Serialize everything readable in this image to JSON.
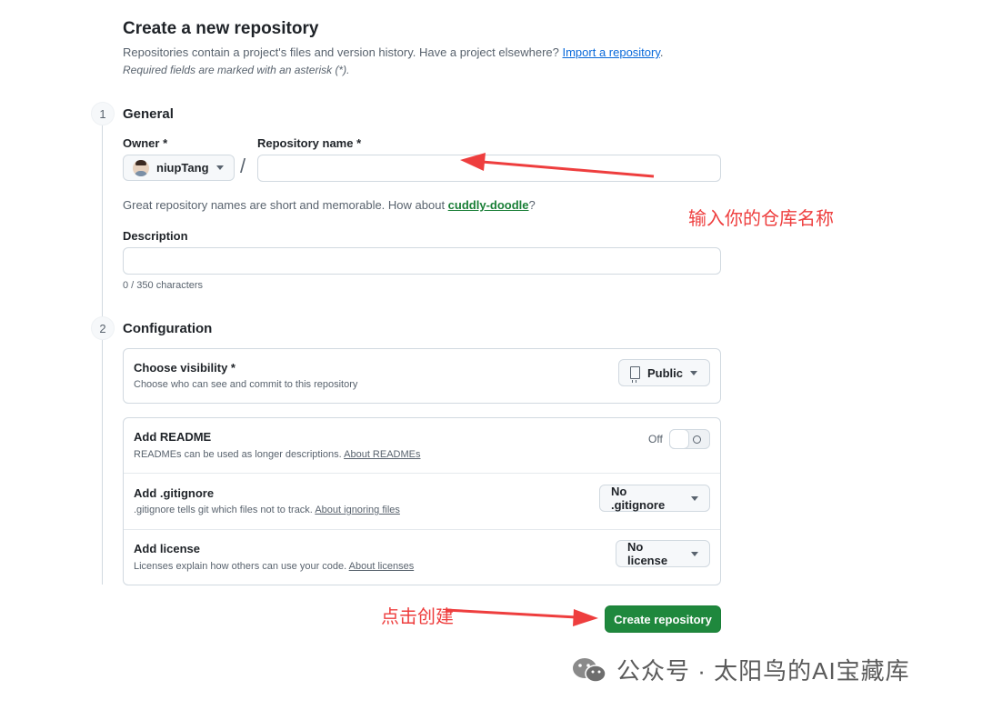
{
  "header": {
    "title": "Create a new repository",
    "subtitle_prefix": "Repositories contain a project's files and version history. Have a project elsewhere? ",
    "import_link": "Import a repository",
    "subtitle_suffix": ".",
    "required_note": "Required fields are marked with an asterisk (*)."
  },
  "general": {
    "step": "1",
    "title": "General",
    "owner_label": "Owner *",
    "owner_value": "niupTang",
    "slash": "/",
    "repo_name_label": "Repository name *",
    "repo_name_value": "",
    "hint_prefix": "Great repository names are short and memorable. How about ",
    "hint_suggestion": "cuddly-doodle",
    "hint_suffix": "?",
    "description_label": "Description",
    "description_value": "",
    "char_counter": "0 / 350 characters"
  },
  "configuration": {
    "step": "2",
    "title": "Configuration",
    "visibility": {
      "title": "Choose visibility *",
      "desc": "Choose who can see and commit to this repository",
      "value": "Public"
    },
    "readme": {
      "title": "Add README",
      "desc": "READMEs can be used as longer descriptions. ",
      "link": "About READMEs",
      "toggle_label": "Off",
      "enabled": false
    },
    "gitignore": {
      "title": "Add .gitignore",
      "desc": ".gitignore tells git which files not to track. ",
      "link": "About ignoring files",
      "value": "No .gitignore"
    },
    "license": {
      "title": "Add license",
      "desc": "Licenses explain how others can use your code. ",
      "link": "About licenses",
      "value": "No license"
    }
  },
  "actions": {
    "create_label": "Create repository"
  },
  "annotations": {
    "repo_name_tip": "输入你的仓库名称",
    "create_tip": "点击创建",
    "color": "#ee3e3e"
  },
  "watermark": {
    "text": "公众号 · 太阳鸟的AI宝藏库"
  },
  "colors": {
    "primary_button": "#1f883d",
    "link": "#0969da",
    "suggestion": "#1a7f37"
  }
}
